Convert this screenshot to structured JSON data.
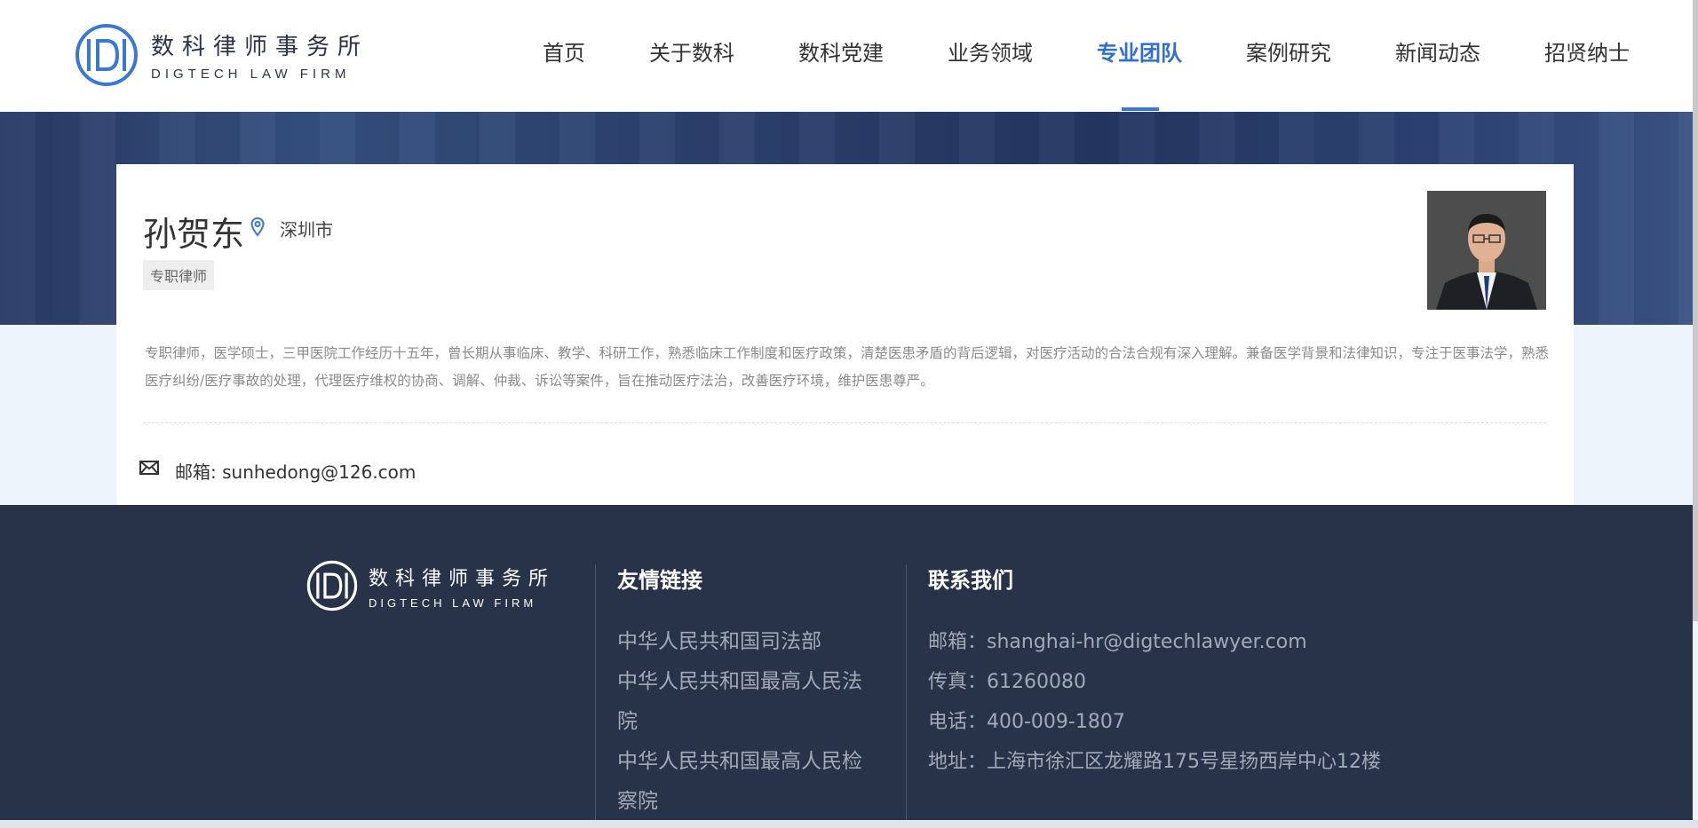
{
  "header": {
    "logo": {
      "cn": "数科律师事务所",
      "en": "DIGTECH LAW FIRM",
      "icon": "firm-logo-icon"
    },
    "nav": [
      {
        "label": "首页",
        "active": false
      },
      {
        "label": "关于数科",
        "active": false
      },
      {
        "label": "数科党建",
        "active": false
      },
      {
        "label": "业务领域",
        "active": false
      },
      {
        "label": "专业团队",
        "active": true
      },
      {
        "label": "案例研究",
        "active": false
      },
      {
        "label": "新闻动态",
        "active": false
      },
      {
        "label": "招贤纳士",
        "active": false
      }
    ],
    "accent_color": "#2f6fcf"
  },
  "profile": {
    "name": "孙贺东",
    "location": "深圳市",
    "location_icon": "location-pin-icon",
    "tag": "专职律师",
    "photo_icon": "lawyer-portrait",
    "bio": "专职律师，医学硕士，三甲医院工作经历十五年，曾长期从事临床、教学、科研工作，熟悉临床工作制度和医疗政策，清楚医患矛盾的背后逻辑，对医疗活动的合法合规有深入理解。兼备医学背景和法律知识，专注于医事法学，熟悉医疗纠纷/医疗事故的处理，代理医疗维权的协商、调解、仲裁、诉讼等案件，旨在推动医疗法治，改善医疗环境，维护医患尊严。",
    "email_label": "邮箱: sunhedong@126.com",
    "email_icon": "mail-icon"
  },
  "footer": {
    "logo": {
      "cn": "数科律师事务所",
      "en": "DIGTECH LAW FIRM"
    },
    "links_heading": "友情链接",
    "links": [
      "中华人民共和国司法部",
      "中华人民共和国最高人民法院",
      "中华人民共和国最高人民检察院"
    ],
    "contact_heading": "联系我们",
    "contacts": [
      "邮箱：shanghai-hr@digtechlawyer.com",
      "传真：61260080",
      "电话：400-009-1807",
      "地址：上海市徐汇区龙耀路175号星扬西岸中心12楼"
    ],
    "background_color": "#283349"
  }
}
